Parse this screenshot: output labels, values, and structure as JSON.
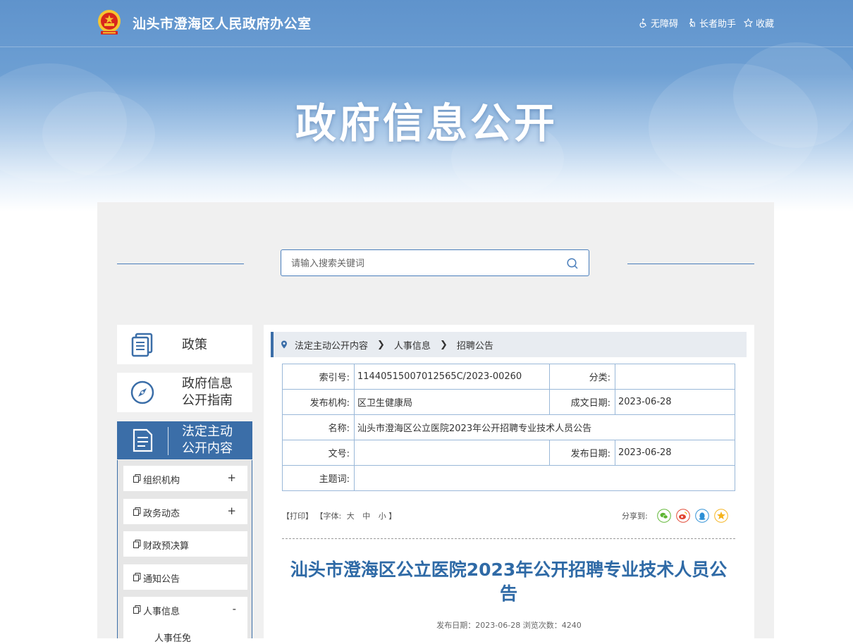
{
  "header": {
    "site_title": "汕头市澄海区人民政府办公室",
    "hero_title": "政府信息公开",
    "utilities": [
      {
        "label": "无障碍",
        "icon": "accessibility-icon"
      },
      {
        "label": "长者助手",
        "icon": "elder-icon"
      },
      {
        "label": "收藏",
        "icon": "star-icon"
      }
    ]
  },
  "search": {
    "placeholder": "请输入搜索关键词"
  },
  "sidebar": {
    "cards": [
      {
        "label": "政策",
        "icon": "book-icon"
      },
      {
        "label": "政府信息\n公开指南",
        "icon": "compass-icon"
      },
      {
        "label": "法定主动\n公开内容",
        "icon": "document-icon",
        "active": true
      }
    ],
    "sub_items": [
      {
        "label": "组织机构",
        "toggle": "+"
      },
      {
        "label": "政务动态",
        "toggle": "+"
      },
      {
        "label": "财政预决算",
        "toggle": ""
      },
      {
        "label": "通知公告",
        "toggle": ""
      },
      {
        "label": "人事信息",
        "toggle": "-"
      }
    ],
    "sub_sub_item": "人事任免"
  },
  "breadcrumb": [
    "法定主动公开内容",
    "人事信息",
    "招聘公告"
  ],
  "meta": {
    "index_label": "索引号:",
    "index_value": "11440515007012565C/2023-00260",
    "category_label": "分类:",
    "category_value": "",
    "publisher_label": "发布机构:",
    "publisher_value": "区卫生健康局",
    "created_label": "成文日期:",
    "created_value": "2023-06-28",
    "name_label": "名称:",
    "name_value": "汕头市澄海区公立医院2023年公开招聘专业技术人员公告",
    "doc_no_label": "文号:",
    "doc_no_value": "",
    "published_label": "发布日期:",
    "published_value": "2023-06-28",
    "subject_label": "主题词:",
    "subject_value": ""
  },
  "tools": {
    "print": "【打印】",
    "font_prefix": "【字体:",
    "font_large": "大",
    "font_medium": "中",
    "font_small": "小",
    "font_suffix": "】",
    "share_label": "分享到:"
  },
  "colors": {
    "wechat": "#5cb531",
    "weibo": "#e0432f",
    "qq": "#2d8fd5",
    "qzone": "#f5b21b"
  },
  "article": {
    "title": "汕头市澄海区公立医院2023年公开招聘专业技术人员公告",
    "meta_line": "发布日期：2023-06-28 浏览次数：4240"
  }
}
